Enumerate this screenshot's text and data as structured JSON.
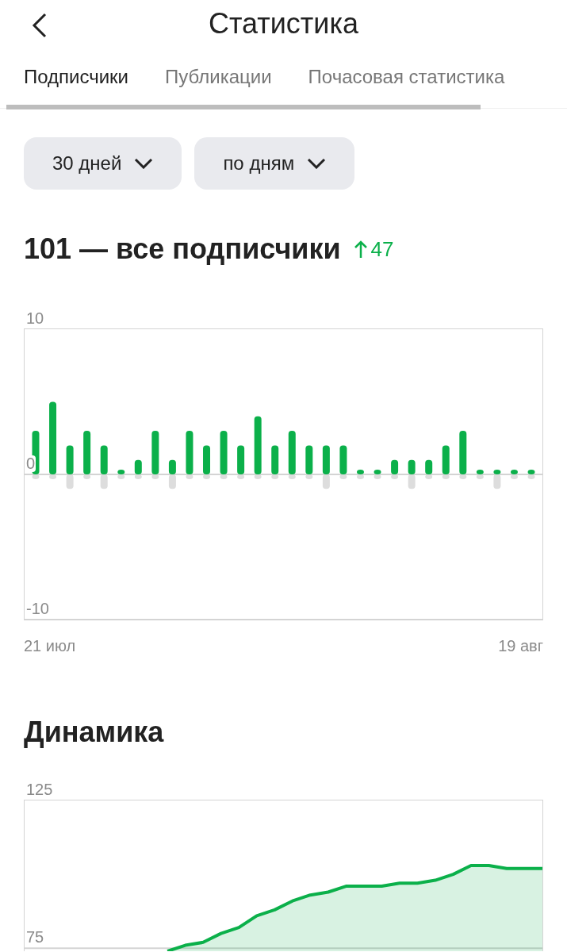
{
  "header": {
    "title": "Статистика"
  },
  "tabs": [
    {
      "label": "Подписчики",
      "selected": true
    },
    {
      "label": "Публикации",
      "selected": false
    },
    {
      "label": "Почасовая статистика",
      "selected": false
    }
  ],
  "filters": [
    {
      "label": "30 дней"
    },
    {
      "label": "по дням"
    }
  ],
  "summary": {
    "total": "101 — все подписчики",
    "change": "47"
  },
  "subscribers_chart": {
    "period": {
      "start": "21 июл",
      "end": "19 авг"
    },
    "chart_data": {
      "type": "bar",
      "stacked": true,
      "categories": [
        null,
        null,
        null,
        null,
        null,
        null,
        null,
        null,
        null,
        null,
        null,
        null,
        null,
        null,
        null,
        null,
        null,
        null,
        null,
        null,
        null,
        null,
        null,
        null,
        null,
        null,
        null,
        null,
        null,
        null
      ],
      "series": [
        {
          "color": "#0bb04a",
          "values": [
            3,
            5,
            2,
            3,
            2,
            0,
            1,
            3,
            1,
            3,
            2,
            3,
            2,
            4,
            2,
            3,
            2,
            2,
            2,
            0,
            0,
            1,
            1,
            1,
            2,
            3,
            0,
            0,
            0,
            0
          ]
        },
        {
          "color": "#dddddd",
          "values": [
            0,
            0,
            -1,
            0,
            -1,
            0,
            0,
            0,
            -1,
            0,
            0,
            0,
            0,
            0,
            0,
            0,
            0,
            -1,
            0,
            0,
            0,
            0,
            -1,
            0,
            0,
            0,
            0,
            -1,
            0,
            0
          ]
        }
      ],
      "ylim": [
        -10,
        10
      ],
      "yticks": [
        10,
        0,
        -10
      ]
    }
  },
  "dynamics": {
    "title": "Динамика",
    "chart_data": {
      "type": "area",
      "categories": [
        null,
        null,
        null,
        null,
        null,
        null,
        null,
        null,
        null,
        null,
        null,
        null,
        null,
        null,
        null,
        null,
        null,
        null,
        null,
        null,
        null,
        null,
        null,
        null,
        null,
        null,
        null,
        null,
        null,
        null
      ],
      "series": [
        {
          "color": "#0bb04a",
          "values": [
            null,
            null,
            null,
            null,
            null,
            null,
            null,
            null,
            74,
            76,
            77,
            80,
            82,
            86,
            88,
            91,
            93,
            94,
            96,
            96,
            96,
            97,
            97,
            98,
            100,
            103,
            103,
            102,
            102,
            102
          ]
        }
      ],
      "ylim": [
        74,
        125
      ],
      "yticks": [
        125,
        75
      ]
    }
  }
}
